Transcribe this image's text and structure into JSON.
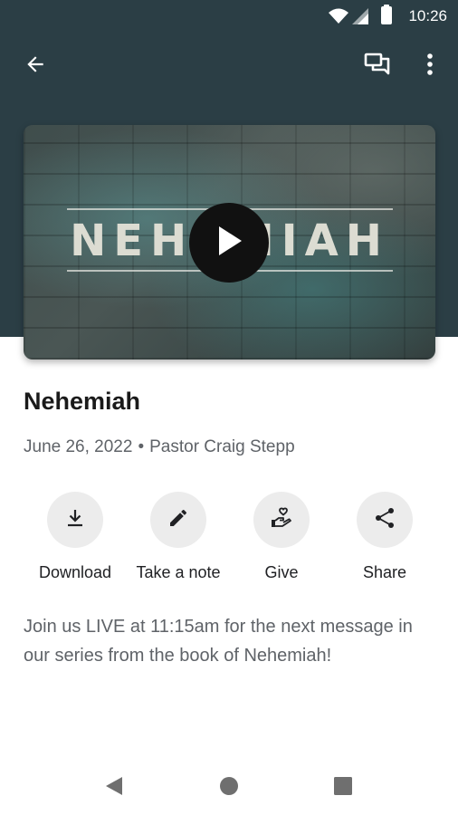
{
  "status_bar": {
    "time": "10:26",
    "icons": [
      "wifi-icon",
      "signal-icon",
      "battery-icon"
    ]
  },
  "toolbar": {
    "back_icon": "arrow-back-icon",
    "chat_icon": "chat-icon",
    "more_icon": "more-vert-icon"
  },
  "video": {
    "artwork_text": "NEHEMIAH",
    "play_icon": "play-icon"
  },
  "sermon": {
    "title": "Nehemiah",
    "date": "June 26, 2022",
    "separator": "•",
    "speaker": "Pastor Craig Stepp"
  },
  "actions": [
    {
      "label": "Download",
      "icon": "download-icon"
    },
    {
      "label": "Take a note",
      "icon": "pencil-icon"
    },
    {
      "label": "Give",
      "icon": "give-heart-hand-icon"
    },
    {
      "label": "Share",
      "icon": "share-icon"
    }
  ],
  "description": "Join us LIVE at 11:15am for the next message in our series from the book of Nehemiah!",
  "nav_bar": {
    "icons": [
      "nav-back-icon",
      "nav-home-icon",
      "nav-recents-icon"
    ]
  },
  "colors": {
    "header_background": "#2b3e45",
    "action_circle": "#ececec",
    "title_text": "#1a1a1a",
    "secondary_text": "#5f6368"
  }
}
